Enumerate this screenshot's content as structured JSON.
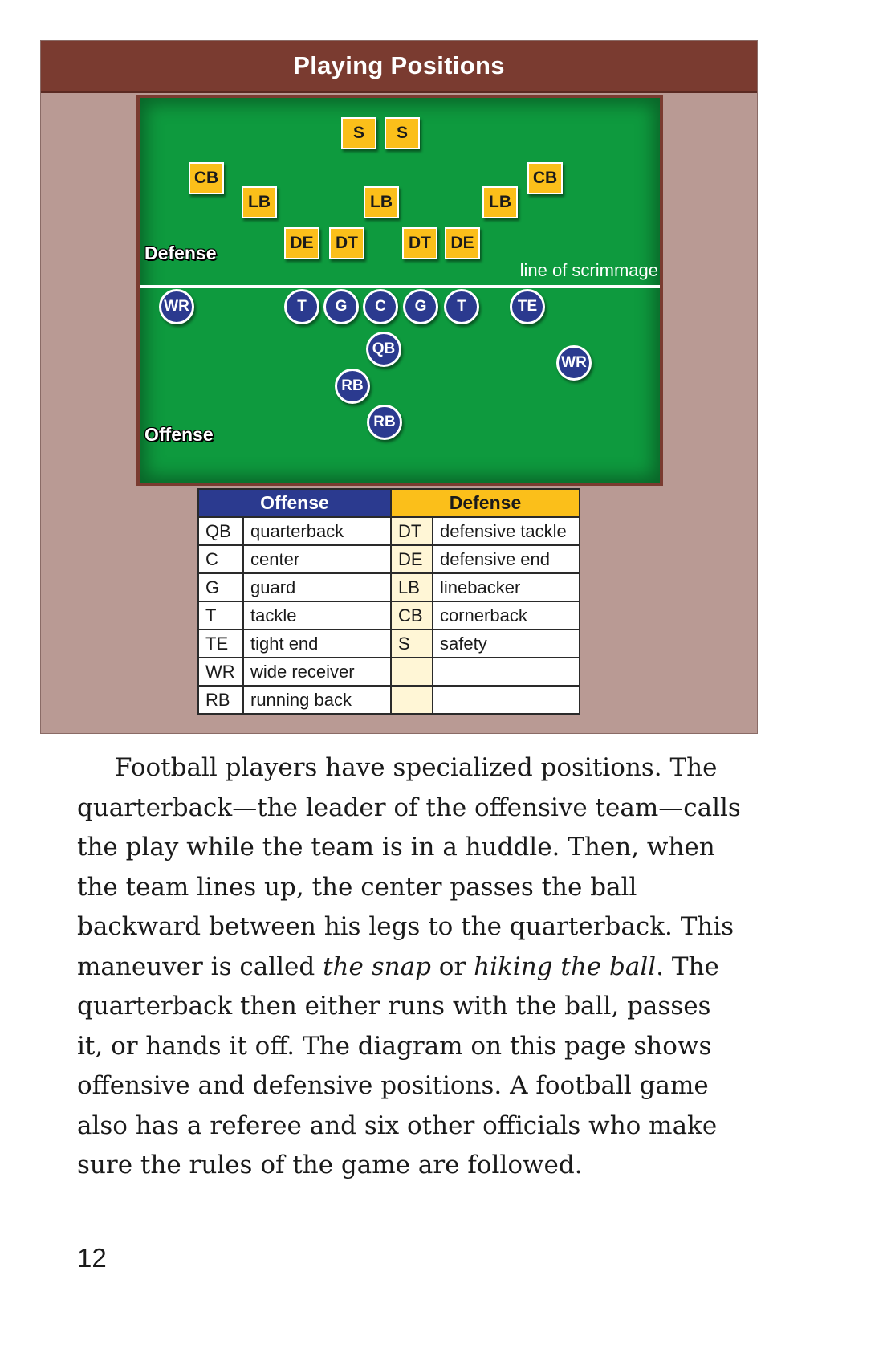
{
  "diagram": {
    "title": "Playing Positions",
    "defense_label": "Defense",
    "offense_label": "Offense",
    "scrimmage_label": "line of scrimmage",
    "defense_players": [
      "S",
      "S",
      "CB",
      "LB",
      "LB",
      "LB",
      "CB",
      "DE",
      "DT",
      "DT",
      "DE"
    ],
    "offense_players": [
      "WR",
      "T",
      "G",
      "C",
      "G",
      "T",
      "TE",
      "QB",
      "WR",
      "RB",
      "RB"
    ]
  },
  "key": {
    "offense_header": "Offense",
    "defense_header": "Defense",
    "offense": [
      {
        "abbr": "QB",
        "name": "quarterback"
      },
      {
        "abbr": "C",
        "name": "center"
      },
      {
        "abbr": "G",
        "name": "guard"
      },
      {
        "abbr": "T",
        "name": "tackle"
      },
      {
        "abbr": "TE",
        "name": "tight end"
      },
      {
        "abbr": "WR",
        "name": "wide receiver"
      },
      {
        "abbr": "RB",
        "name": "running back"
      }
    ],
    "defense": [
      {
        "abbr": "DT",
        "name": "defensive tackle"
      },
      {
        "abbr": "DE",
        "name": "defensive end"
      },
      {
        "abbr": "LB",
        "name": "linebacker"
      },
      {
        "abbr": "CB",
        "name": "cornerback"
      },
      {
        "abbr": "S",
        "name": "safety"
      },
      {
        "abbr": "",
        "name": ""
      },
      {
        "abbr": "",
        "name": ""
      }
    ]
  },
  "text": {
    "p1_a": "Football players have specialized positions. The quarterback—the leader of the offensive team—calls the play while the team is in a huddle. Then, when the team lines up, the center passes the ball backward between his legs to the quarterback. This maneuver is called ",
    "snap": "the snap",
    "or": " or ",
    "hiking": "hiking the ball",
    "p1_b": ". The quarterback then either runs with the ball, passes it, or hands it off. The diagram on this page shows offensive and defensive positions. A football game also has a referee and six other officials who make sure the rules of the game are followed."
  },
  "page_number": "12",
  "colors": {
    "offense": "#2b3a8f",
    "defense": "#fbbf1a",
    "field": "#0e9a3e",
    "title_bar": "#7a3b30",
    "panel": "#b99a94"
  }
}
